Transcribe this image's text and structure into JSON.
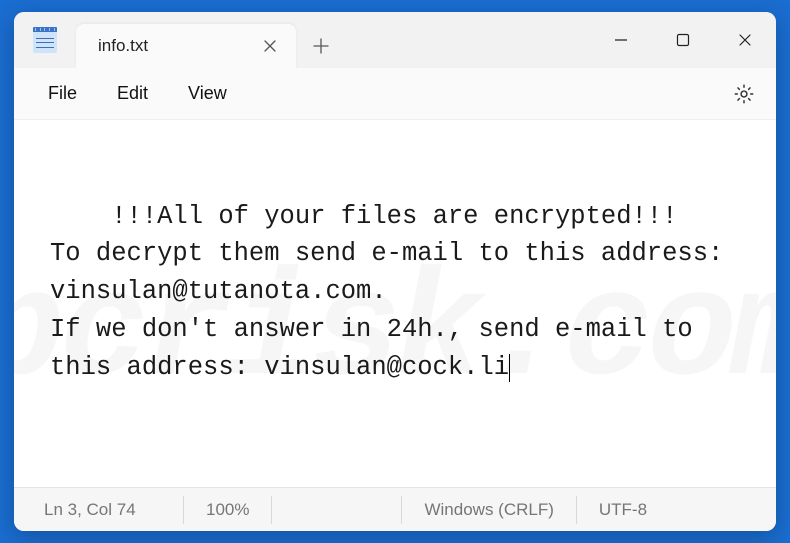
{
  "tab": {
    "title": "info.txt"
  },
  "menu": {
    "file": "File",
    "edit": "Edit",
    "view": "View"
  },
  "content": {
    "text": "!!!All of your files are encrypted!!!\nTo decrypt them send e-mail to this address: vinsulan@tutanota.com.\nIf we don't answer in 24h., send e-mail to this address: vinsulan@cock.li"
  },
  "status": {
    "position": "Ln 3, Col 74",
    "zoom": "100%",
    "line_ending": "Windows (CRLF)",
    "encoding": "UTF-8"
  },
  "watermark": "pcrisk.com"
}
